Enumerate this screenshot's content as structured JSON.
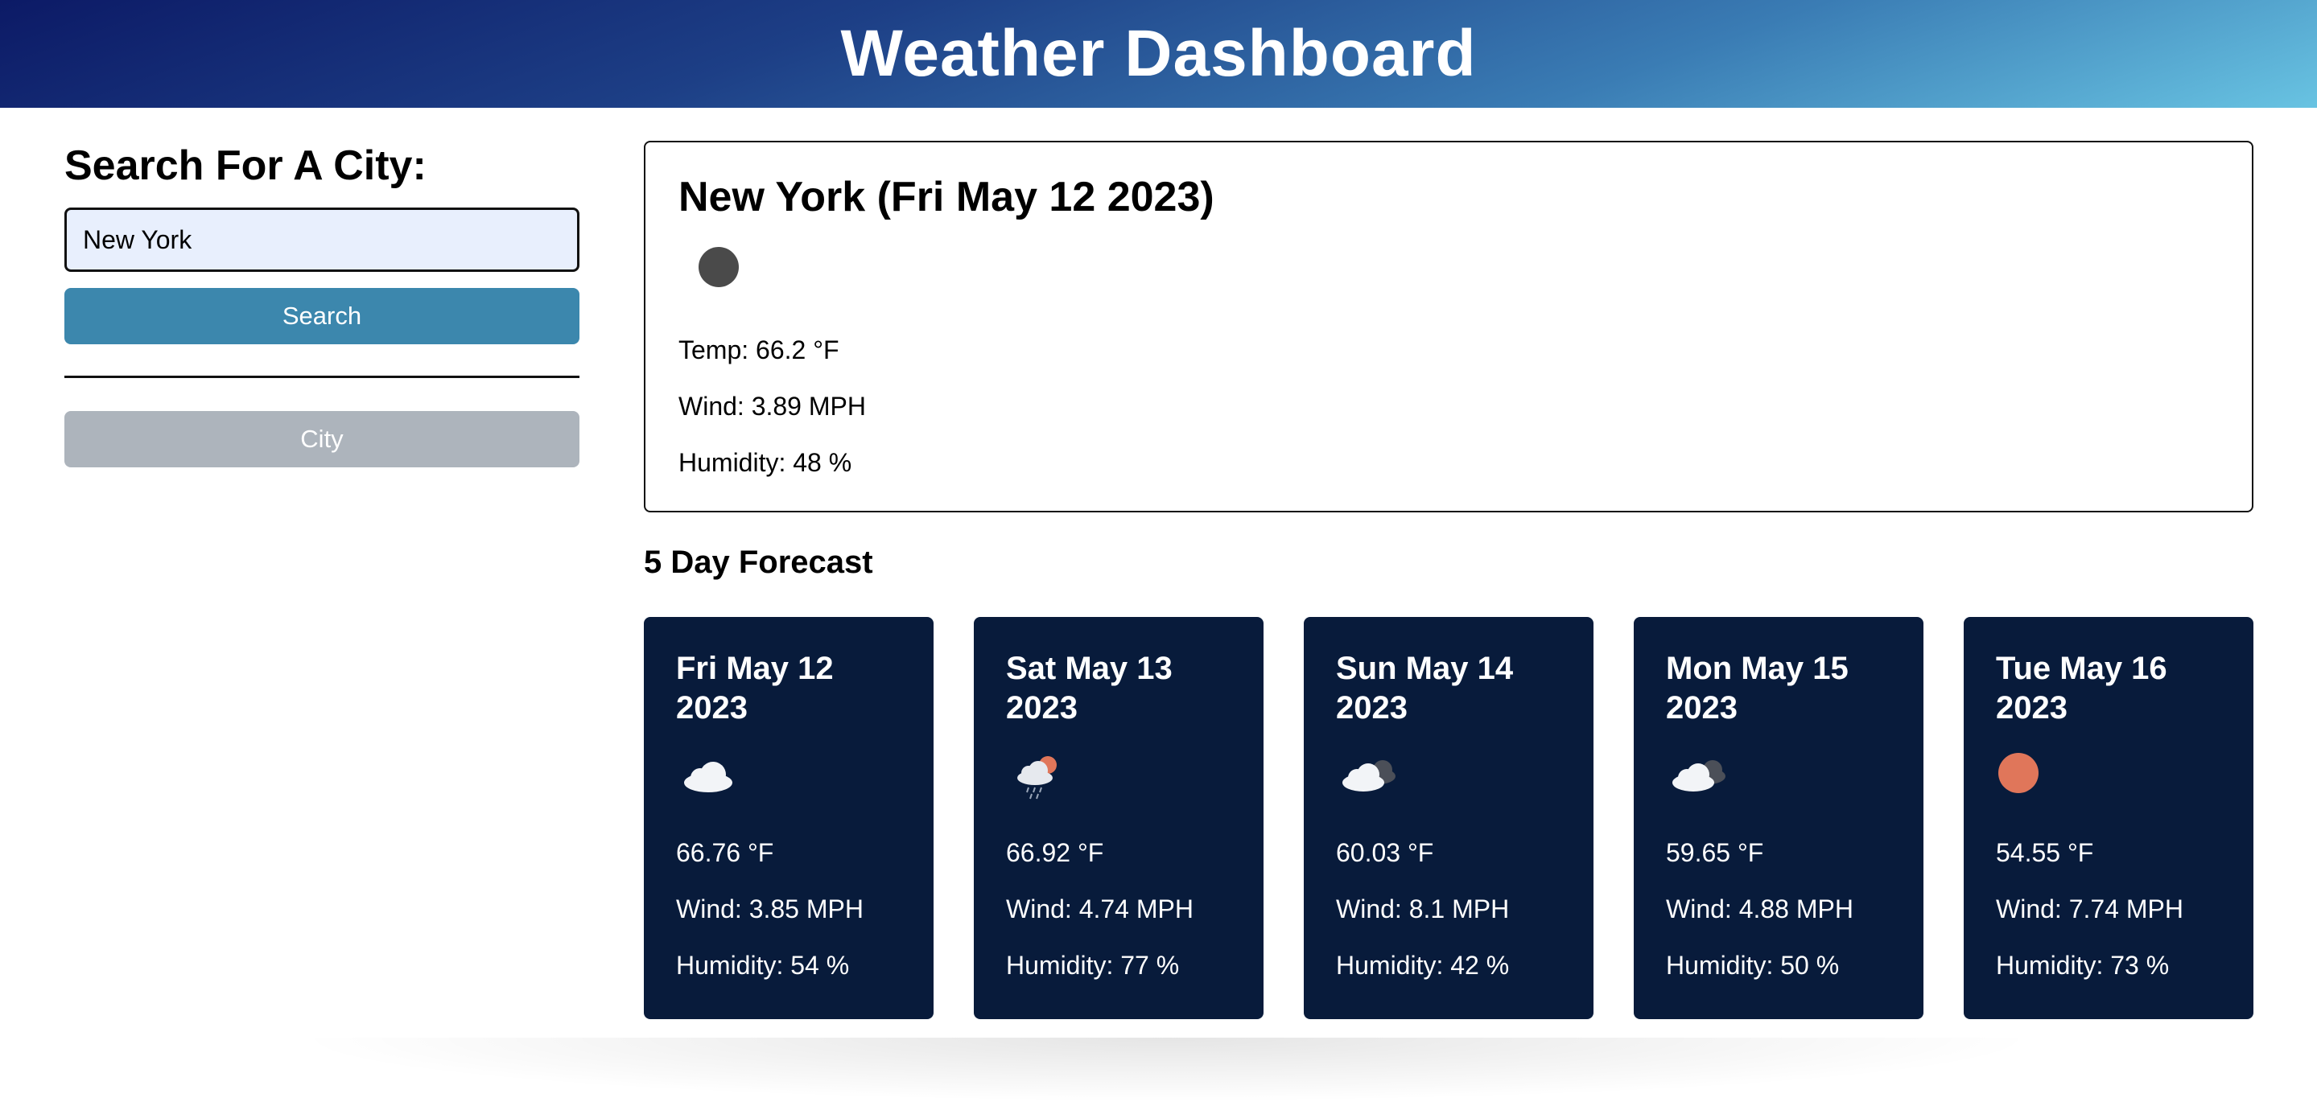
{
  "header": {
    "title": "Weather Dashboard"
  },
  "sidebar": {
    "heading": "Search For A City:",
    "search_value": "New York",
    "search_button": "Search",
    "history": [
      "City"
    ]
  },
  "current": {
    "title": "New York (Fri May 12 2023)",
    "icon": "dark-circle-icon",
    "temp": "Temp: 66.2 °F",
    "wind": "Wind: 3.89 MPH",
    "humidity": "Humidity: 48 %"
  },
  "forecast": {
    "title": "5 Day Forecast",
    "days": [
      {
        "date": "Fri May 12 2023",
        "icon": "cloud-icon",
        "temp": "66.76 °F",
        "wind": "Wind: 3.85 MPH",
        "humidity": "Humidity: 54 %"
      },
      {
        "date": "Sat May 13 2023",
        "icon": "rain-sun-cloud-icon",
        "temp": "66.92 °F",
        "wind": "Wind: 4.74 MPH",
        "humidity": "Humidity: 77 %"
      },
      {
        "date": "Sun May 14 2023",
        "icon": "broken-clouds-icon",
        "temp": "60.03 °F",
        "wind": "Wind: 8.1 MPH",
        "humidity": "Humidity: 42 %"
      },
      {
        "date": "Mon May 15 2023",
        "icon": "broken-clouds-icon",
        "temp": "59.65 °F",
        "wind": "Wind: 4.88 MPH",
        "humidity": "Humidity: 50 %"
      },
      {
        "date": "Tue May 16 2023",
        "icon": "sun-icon",
        "temp": "54.55 °F",
        "wind": "Wind: 7.74 MPH",
        "humidity": "Humidity: 73 %"
      }
    ]
  },
  "colors": {
    "card_bg": "#081b3b",
    "search_button": "#3c87ad",
    "history_button": "#adb4bc",
    "input_bg": "#e8effd",
    "sun": "#e0765a"
  }
}
